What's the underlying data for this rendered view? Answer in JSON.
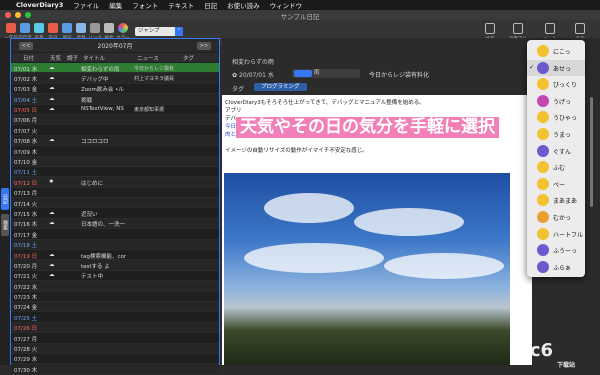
{
  "menubar": {
    "app_name": "CloverDiary3",
    "items": [
      "ファイル",
      "編集",
      "フォント",
      "テキスト",
      "日記",
      "お使い読み",
      "ウィンドウ"
    ]
  },
  "window": {
    "title": "サンプル日記"
  },
  "toolbar": {
    "buttons": [
      {
        "label": "一年前",
        "color": "#e85c4a"
      },
      {
        "label": "前年度",
        "color": "#5a9be8"
      },
      {
        "label": "前月",
        "color": "#5ac8e8"
      },
      {
        "label": "前日",
        "color": "#e85c4a"
      },
      {
        "label": "翌日",
        "color": "#5a9be8"
      },
      {
        "label": "翌月",
        "color": "#8ab8e8"
      },
      {
        "label": "リンク",
        "color": "#999999"
      },
      {
        "label": "検索",
        "color": "#bbbbbb"
      },
      {
        "label": "カラー",
        "color": "#e8a54a"
      }
    ],
    "jump_label": "ジャンプ",
    "web_label": "Web",
    "right_buttons": [
      {
        "label": "共有"
      },
      {
        "label": "画像アル"
      },
      {
        "label": "メール"
      },
      {
        "label": "表示"
      }
    ]
  },
  "sidebar_tabs": [
    "日記",
    "検索"
  ],
  "calendar": {
    "month_label": "2020年07月",
    "prev_label": "<<",
    "next_label": ">>",
    "columns": [
      "日付",
      "天気",
      "調子",
      "タイトル",
      "ニュース",
      "タグ"
    ],
    "rows": [
      {
        "date": "07/01 水",
        "kind": "sel",
        "wx": "☁",
        "mood": "#6a5acd",
        "title": "相変わらずの雨",
        "news": "今日からレジ袋有",
        "tag": "ブログ…"
      },
      {
        "date": "07/02 木",
        "kind": "",
        "wx": "☁",
        "mood": "#e8c04a",
        "title": "デバッグ中",
        "news": "村上マヨネラ議員",
        "tag": ""
      },
      {
        "date": "07/03 金",
        "kind": "",
        "wx": "☁",
        "mood": "#e8c04a",
        "title": "Zoom飲み会 •ル",
        "news": "",
        "tag": ""
      },
      {
        "date": "07/04 土",
        "kind": "sat",
        "wx": "☁",
        "mood": "#d04aa0",
        "title": "挑戦",
        "news": "",
        "tag": ""
      },
      {
        "date": "07/05 日",
        "kind": "sun",
        "wx": "☁",
        "mood": "#e8c04a",
        "title": "NSTextView, NS",
        "news": "東京都知事選",
        "tag": "ブログ…"
      },
      {
        "date": "07/06 月",
        "kind": "",
        "wx": "",
        "mood": "",
        "title": "",
        "news": "",
        "tag": ""
      },
      {
        "date": "07/07 火",
        "kind": "",
        "wx": "",
        "mood": "",
        "title": "",
        "news": "",
        "tag": ""
      },
      {
        "date": "07/08 水",
        "kind": "",
        "wx": "☁",
        "mood": "#6a5acd",
        "title": "ココロコロ",
        "news": "",
        "tag": ""
      },
      {
        "date": "07/09 木",
        "kind": "",
        "wx": "",
        "mood": "",
        "title": "",
        "news": "",
        "tag": ""
      },
      {
        "date": "07/10 金",
        "kind": "",
        "wx": "",
        "mood": "",
        "title": "",
        "news": "",
        "tag": ""
      },
      {
        "date": "07/11 土",
        "kind": "sat",
        "wx": "",
        "mood": "",
        "title": "",
        "news": "",
        "tag": ""
      },
      {
        "date": "07/12 日",
        "kind": "sun",
        "wx": "✹",
        "mood": "#e8c04a",
        "title": "はじめに",
        "news": "",
        "tag": ""
      },
      {
        "date": "07/13 月",
        "kind": "",
        "wx": "",
        "mood": "",
        "title": "",
        "news": "",
        "tag": ""
      },
      {
        "date": "07/14 火",
        "kind": "",
        "wx": "",
        "mood": "",
        "title": "",
        "news": "",
        "tag": ""
      },
      {
        "date": "07/15 水",
        "kind": "",
        "wx": "☁",
        "mood": "#e8c04a",
        "title": "近況い",
        "news": "",
        "tag": ""
      },
      {
        "date": "07/16 木",
        "kind": "",
        "wx": "☁",
        "mood": "#6a5acd",
        "title": "日本語の、一洗一",
        "news": "",
        "tag": "ブログ…"
      },
      {
        "date": "07/17 金",
        "kind": "",
        "wx": "",
        "mood": "",
        "title": "",
        "news": "",
        "tag": ""
      },
      {
        "date": "07/18 土",
        "kind": "sat",
        "wx": "",
        "mood": "",
        "title": "",
        "news": "",
        "tag": ""
      },
      {
        "date": "07/19 日",
        "kind": "sun",
        "wx": "☁",
        "mood": "#e8c04a",
        "title": "tag検索機能、cor",
        "news": "",
        "tag": "ブログ…"
      },
      {
        "date": "07/20 月",
        "kind": "",
        "wx": "☁",
        "mood": "#e8c04a",
        "title": "testする よ",
        "news": "",
        "tag": "映画"
      },
      {
        "date": "07/21 火",
        "kind": "",
        "wx": "☁",
        "mood": "#6a5acd",
        "title": "テスト中",
        "news": "",
        "tag": ""
      },
      {
        "date": "07/22 水",
        "kind": "",
        "wx": "",
        "mood": "",
        "title": "",
        "news": "",
        "tag": ""
      },
      {
        "date": "07/23 木",
        "kind": "",
        "wx": "",
        "mood": "",
        "title": "",
        "news": "",
        "tag": ""
      },
      {
        "date": "07/24 金",
        "kind": "",
        "wx": "",
        "mood": "",
        "title": "",
        "news": "",
        "tag": ""
      },
      {
        "date": "07/25 土",
        "kind": "sat",
        "wx": "",
        "mood": "",
        "title": "",
        "news": "",
        "tag": ""
      },
      {
        "date": "07/26 日",
        "kind": "sun",
        "wx": "",
        "mood": "",
        "title": "",
        "news": "",
        "tag": ""
      },
      {
        "date": "07/27 月",
        "kind": "",
        "wx": "",
        "mood": "",
        "title": "",
        "news": "",
        "tag": ""
      },
      {
        "date": "07/28 火",
        "kind": "",
        "wx": "",
        "mood": "",
        "title": "",
        "news": "",
        "tag": ""
      },
      {
        "date": "07/29 水",
        "kind": "",
        "wx": "",
        "mood": "",
        "title": "",
        "news": "",
        "tag": ""
      },
      {
        "date": "07/30 木",
        "kind": "",
        "wx": "",
        "mood": "",
        "title": "",
        "news": "",
        "tag": ""
      },
      {
        "date": "07/31 金",
        "kind": "",
        "wx": "",
        "mood": "",
        "title": "",
        "news": "",
        "tag": ""
      }
    ]
  },
  "entry": {
    "title": "相変わらずの雨",
    "date": "20/07/01 水",
    "weather": "雨",
    "news": "今日からレジ袋有料化",
    "tag_label": "タグ",
    "tag": "プログラミング",
    "headline": "天気やその日の気分を手軽に選択",
    "lines": [
      {
        "text": "CloverDiary3もそろそろ仕上がってきて、デバッグとマニュアル整備を始める。",
        "blue": false
      },
      {
        "text": "アプリ",
        "blue": false
      },
      {
        "text": "デバ",
        "blue": false
      },
      {
        "text": "今日からレジ袋有料化。批判もいろいろあるみたいだけど野放しにするよりはずっとマシでは？とは思う。",
        "blue": true
      },
      {
        "text": "肉とか買ったときの透明な袋は引き続き無料みたいだけど、あれが有料になるとさすがに困るかも。",
        "blue": true
      },
      {
        "text": "",
        "blue": false
      },
      {
        "text": "イメージの自動リサイズの動作がイマイチ不安定な感じ。",
        "blue": false
      }
    ]
  },
  "emoji_menu": {
    "items": [
      {
        "label": "にこっ",
        "color": "#f2c230",
        "checked": false
      },
      {
        "label": "あせっ",
        "color": "#6a5acd",
        "checked": true
      },
      {
        "label": "びっくり",
        "color": "#f2c230",
        "checked": false
      },
      {
        "label": "うげっ",
        "color": "#c04ab0",
        "checked": false
      },
      {
        "label": "うひゃっ",
        "color": "#f2c230",
        "checked": false
      },
      {
        "label": "うまっ",
        "color": "#f2c230",
        "checked": false
      },
      {
        "label": "ぐすん",
        "color": "#6a5acd",
        "checked": false
      },
      {
        "label": "ふむ",
        "color": "#f2c230",
        "checked": false
      },
      {
        "label": "ペー",
        "color": "#f2c230",
        "checked": false
      },
      {
        "label": "まあまあ",
        "color": "#f2c230",
        "checked": false
      },
      {
        "label": "むかっ",
        "color": "#e8a030",
        "checked": false
      },
      {
        "label": "ハートフル",
        "color": "#f2c230",
        "checked": false
      },
      {
        "label": "ふうーっ",
        "color": "#6a5acd",
        "checked": false
      },
      {
        "label": "ふらぁ",
        "color": "#6a5acd",
        "checked": false
      }
    ]
  },
  "watermark": {
    "text": "pc6",
    "sub": "下载站"
  },
  "colors": {
    "accent": "#3478f6",
    "selected_row": "#2e7d32",
    "tag_blue": "#2d5fa8",
    "headline_pink": "#f27fb8"
  }
}
